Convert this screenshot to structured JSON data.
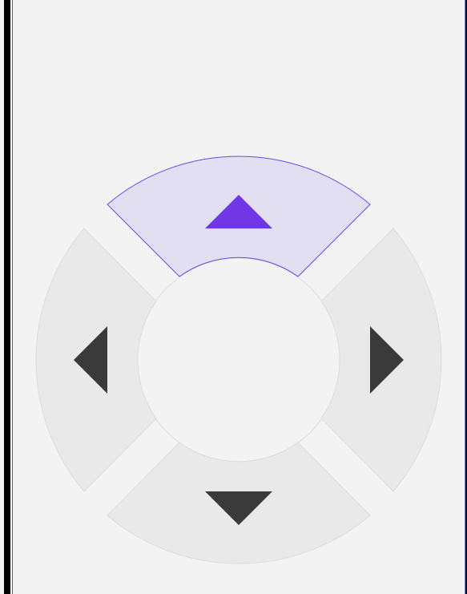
{
  "dpad": {
    "active_direction": "up",
    "buttons": [
      {
        "id": "up",
        "icon": "arrow-up-icon",
        "active": true
      },
      {
        "id": "right",
        "icon": "arrow-right-icon",
        "active": false
      },
      {
        "id": "down",
        "icon": "arrow-down-icon",
        "active": false
      },
      {
        "id": "left",
        "icon": "arrow-left-icon",
        "active": false
      }
    ]
  },
  "colors": {
    "background": "#f3f3f3",
    "segment_fill": "#e9e9e9",
    "segment_stroke": "#dcdcdc",
    "active_fill": "#e3dff3",
    "active_stroke": "#6a46ec",
    "active_arrow": "#7137e6",
    "arrow": "#3a3a3a"
  }
}
